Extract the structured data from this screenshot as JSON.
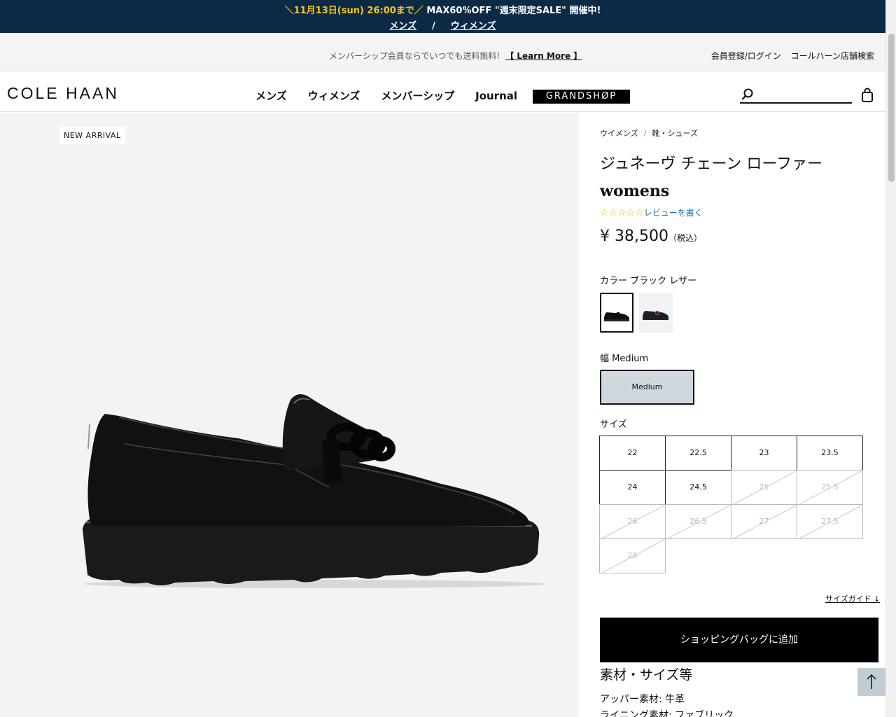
{
  "promo": {
    "line1_highlight": "＼11月13日(sun) 26:00まで／",
    "line1_text": " MAX60%OFF \"週末限定SALE\" 開催中!",
    "link_mens": "メンズ",
    "separator": "/",
    "link_womens": "ウィメンズ"
  },
  "utility": {
    "message": "メンバーシップ会員ならでいつでも送料無料!",
    "learn_more": "【 Learn More 】",
    "login": "会員登録/ログイン",
    "store_search": "コールハーン店舗検索"
  },
  "header": {
    "logo": "COLE HAAN",
    "nav": [
      "メンズ",
      "ウィメンズ",
      "メンバーシップ",
      "Journal"
    ],
    "grandshop": "GRANDSHØP"
  },
  "gallery": {
    "badge": "NEW ARRIVAL"
  },
  "product": {
    "breadcrumb": [
      "ウイメンズ",
      "靴・シューズ"
    ],
    "breadcrumb_sep": "/",
    "title_jp": "ジュネーヴ チェーン ローファー",
    "title_en": "womens",
    "stars": "☆☆☆☆☆",
    "review_link": "レビューを書く",
    "price": "¥ 38,500",
    "price_tax": "（税込）",
    "color_label": "カラー ブラック レザー",
    "width_label": "幅 Medium",
    "width_option": "Medium",
    "size_label": "サイズ",
    "sizes": [
      {
        "label": "22",
        "available": true
      },
      {
        "label": "22.5",
        "available": true
      },
      {
        "label": "23",
        "available": true
      },
      {
        "label": "23.5",
        "available": true
      },
      {
        "label": "24",
        "available": true
      },
      {
        "label": "24.5",
        "available": true
      },
      {
        "label": "25",
        "available": false
      },
      {
        "label": "25.5",
        "available": false
      },
      {
        "label": "26",
        "available": false
      },
      {
        "label": "26.5",
        "available": false
      },
      {
        "label": "27",
        "available": false
      },
      {
        "label": "27.5",
        "available": false
      },
      {
        "label": "28",
        "available": false
      }
    ],
    "size_guide": "サイズガイド ↓",
    "add_to_bag": "ショッピングバッグに追加",
    "materials_heading": "素材・サイズ等",
    "material_upper": "アッパー素材: 牛革",
    "material_lining": "ライニング素材: ファブリック"
  },
  "colors": {
    "banner": "#0d2a45",
    "highlight": "#f5c518",
    "width_selected": "#cfd8de",
    "link": "#1a6fb5"
  }
}
